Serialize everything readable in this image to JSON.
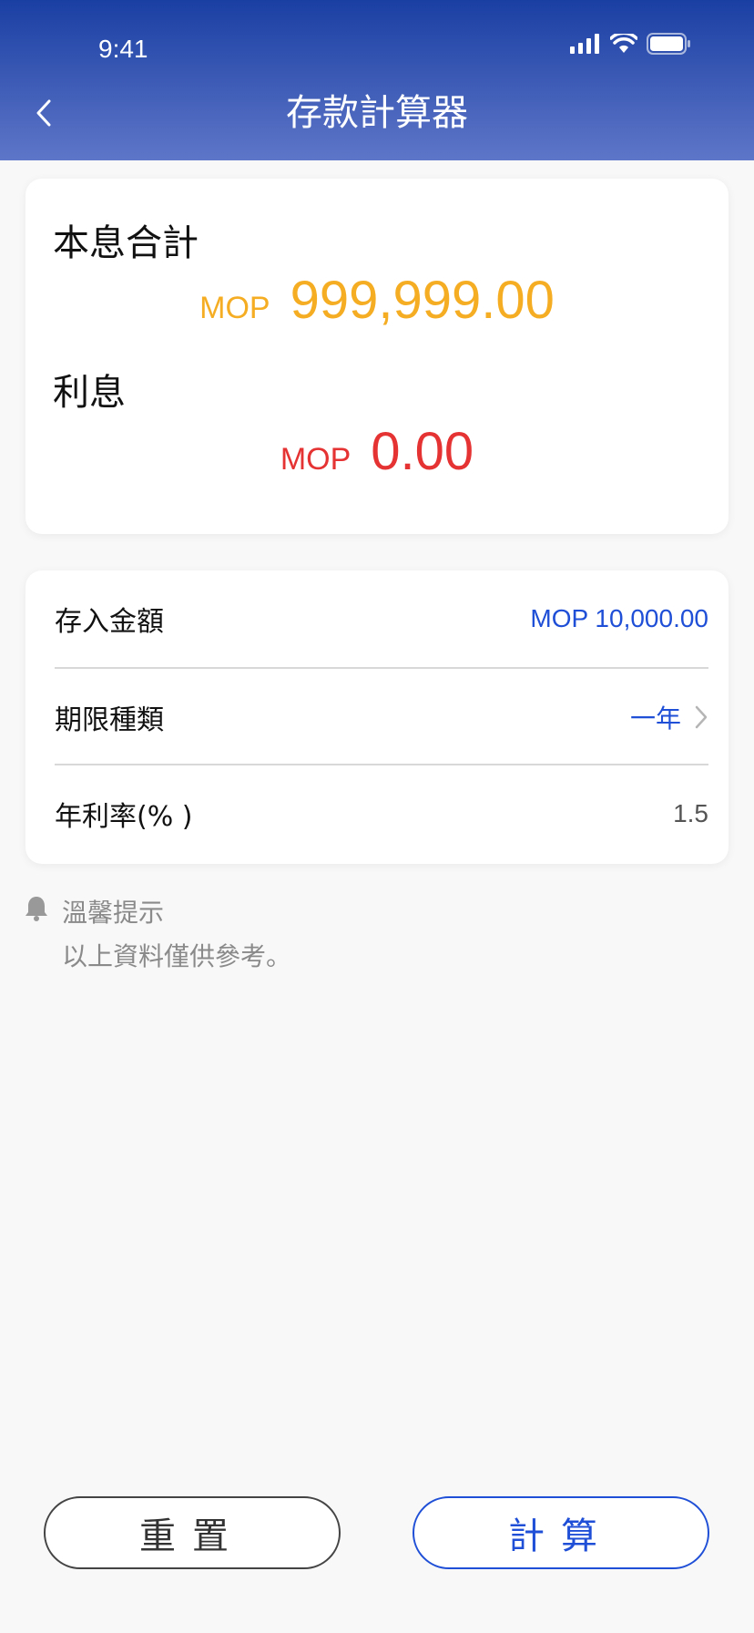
{
  "status_bar": {
    "time": "9:41"
  },
  "header": {
    "title": "存款計算器"
  },
  "result": {
    "total_label": "本息合計",
    "total_currency": "MOP",
    "total_amount": "999,999.00",
    "interest_label": "利息",
    "interest_currency": "MOP",
    "interest_amount": "0.00"
  },
  "form": {
    "deposit_label": "存入金額",
    "deposit_value": "MOP 10,000.00",
    "term_label": "期限種類",
    "term_value": "一年",
    "rate_label": "年利率(% )",
    "rate_value": "1.5"
  },
  "tip": {
    "title": "溫馨提示",
    "text": "以上資料僅供參考。"
  },
  "buttons": {
    "reset": "重置",
    "calculate": "計算"
  },
  "colors": {
    "header_top": "#1a3fa3",
    "header_bottom": "#5e76c8",
    "accent_blue": "#1f4fd6",
    "total_orange": "#f5ad23",
    "interest_red": "#e53232"
  },
  "icons": [
    "signal-icon",
    "wifi-icon",
    "battery-icon",
    "back-chevron-icon",
    "chevron-right-icon",
    "bell-icon"
  ]
}
